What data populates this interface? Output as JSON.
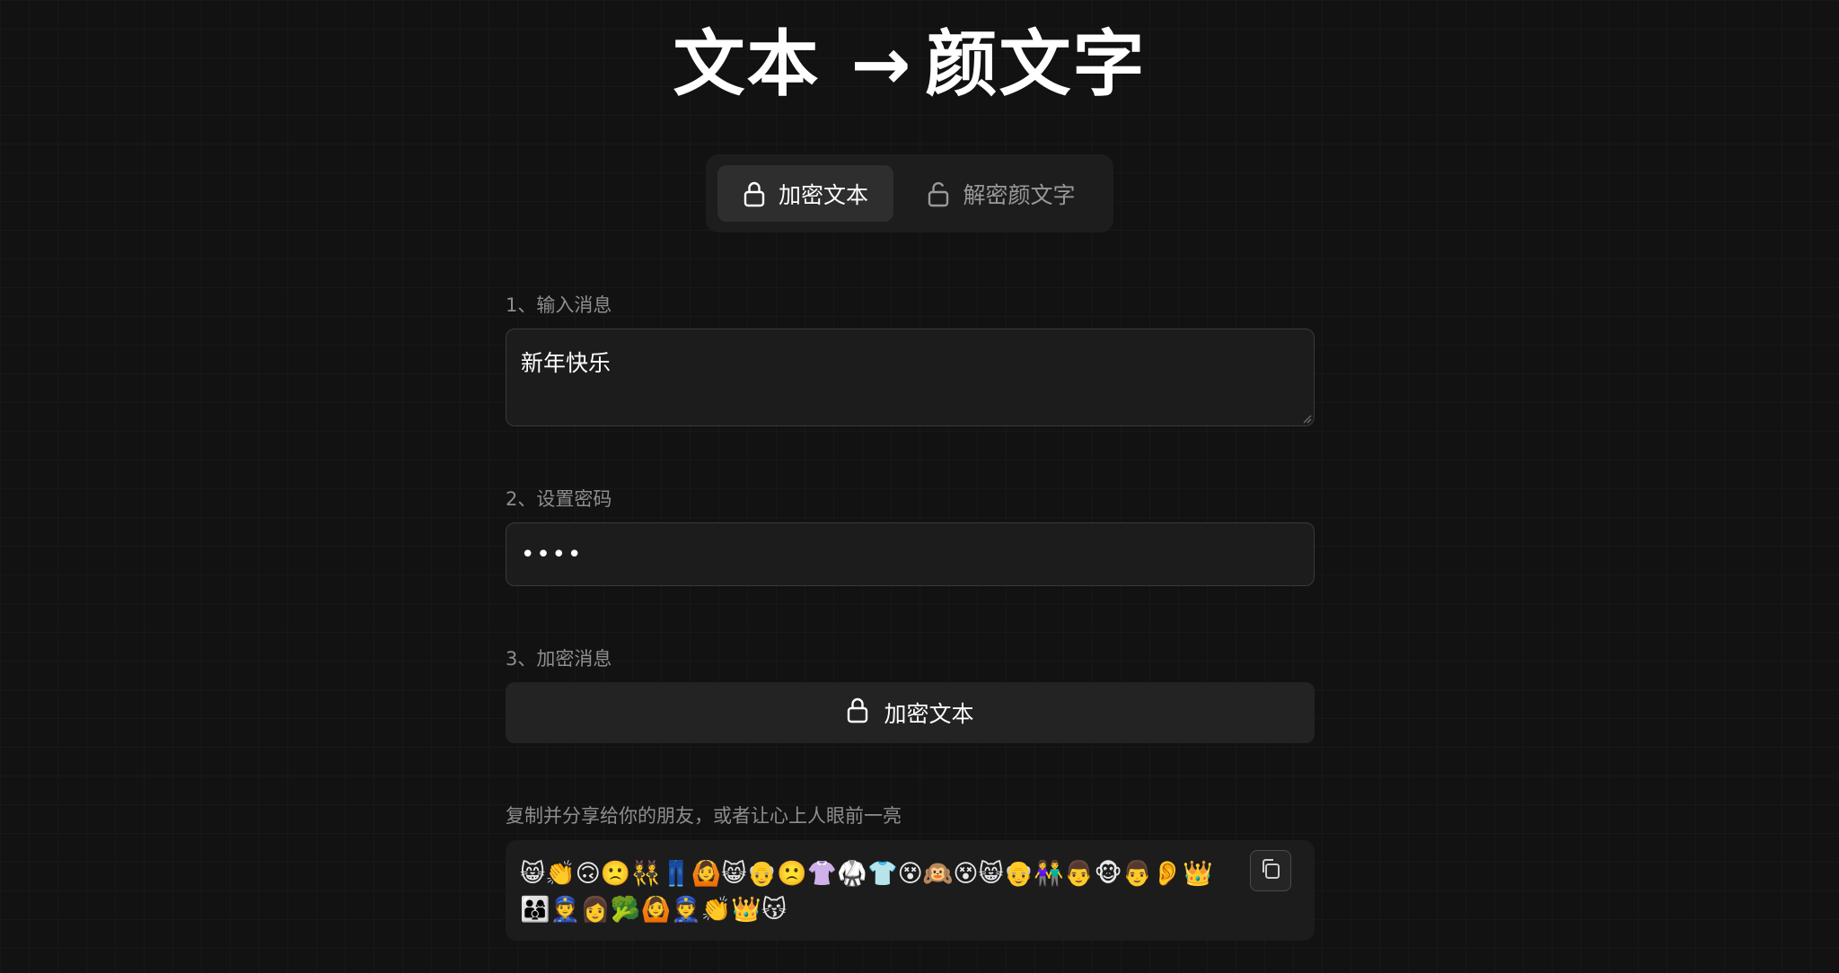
{
  "header": {
    "title_left": "文本",
    "title_arrow": "→",
    "title_right": "颜文字"
  },
  "tabs": [
    {
      "label": "加密文本",
      "icon": "lock-icon",
      "active": true
    },
    {
      "label": "解密颜文字",
      "icon": "unlock-icon",
      "active": false
    }
  ],
  "form": {
    "message_label": "1、输入消息",
    "message_value": "新年快乐",
    "password_label": "2、设置密码",
    "password_value": "••••",
    "encrypt_label": "3、加密消息",
    "encrypt_button_label": "加密文本"
  },
  "output": {
    "label": "复制并分享给你的朋友，或者让心上人眼前一亮",
    "value": "😸👏🙃🙁👯👖🙆😸👴🙁👚🥋👕😵🙉😵😸👴👫👨🐵👨👂👑👨‍👩‍👦👮👩🥦🙆👮👏👑😽"
  },
  "colors": {
    "background": "#121212",
    "panel": "#1c1c1c",
    "active_tab": "#2e2e2e",
    "text_primary": "#ffffff",
    "text_muted": "#8e8e8e"
  }
}
